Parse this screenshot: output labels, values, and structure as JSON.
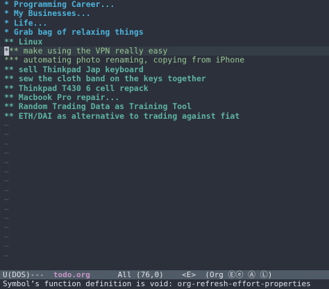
{
  "buffer": {
    "lines": [
      {
        "level": 1,
        "text": "* Programming Career..."
      },
      {
        "level": 1,
        "text": "* My Businesses..."
      },
      {
        "level": 1,
        "text": "* Life..."
      },
      {
        "level": 1,
        "text": "* Grab bag of relaxing things"
      },
      {
        "level": 2,
        "text": "** Linux"
      },
      {
        "level": 3,
        "cursor_char": "*",
        "text": "** make using the VPN really easy"
      },
      {
        "level": 3,
        "text": "*** automating photo renaming, copying from iPhone"
      },
      {
        "level": 2,
        "text": "** sell Thinkpad Jap keyboard"
      },
      {
        "level": 2,
        "text": "** sew the cloth band on the keys together"
      },
      {
        "level": 2,
        "text": "** Thinkpad T430 6 cell repack"
      },
      {
        "level": 2,
        "text": "** Macbook Pro repair..."
      },
      {
        "level": 2,
        "text": "** Random Trading Data as Training Tool"
      },
      {
        "level": 2,
        "text": "** ETH/DAI as alternative to trading against fiat"
      }
    ],
    "empty_line_marker": "~"
  },
  "modeline": {
    "prefix": "U(DOS)---  ",
    "buffer_name": "todo.org",
    "suffix": "      All (76,0)    <E>  (Org Ⓔⓔ Ⓐ Ⓛ)"
  },
  "minibuffer": {
    "message": "Symbol’s function definition is void: org-refresh-effort-properties"
  },
  "colors": {
    "background": "#2b303b",
    "heading_level1": "#4fb3d9",
    "heading_level2": "#5fb3a1",
    "heading_level3": "#99c794",
    "tilde": "#4f5b66",
    "modeline_bg": "#4f5b66"
  }
}
